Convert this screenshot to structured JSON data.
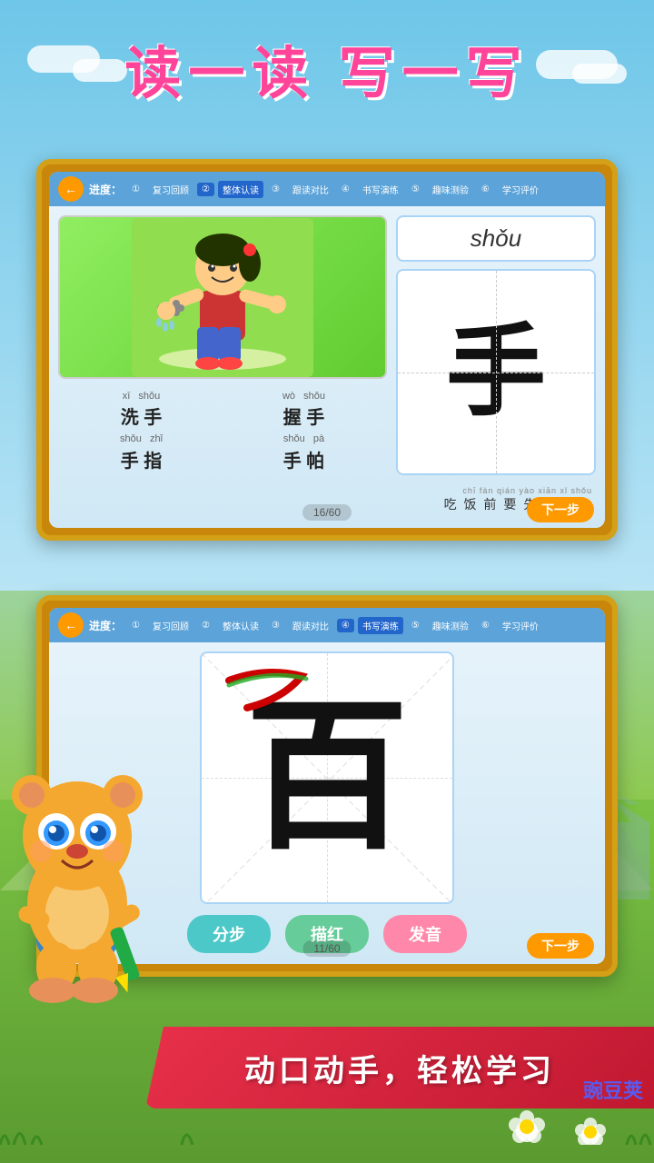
{
  "app": {
    "title": "读一读 写一写",
    "brand": "豌豆荚"
  },
  "card1": {
    "back_label": "←",
    "progress_label": "进度：",
    "steps": [
      {
        "num": "①",
        "label": "复习回顾",
        "active": false
      },
      {
        "num": "②",
        "label": "整体认读",
        "active": true
      },
      {
        "num": "③",
        "label": "跟读对比",
        "active": false
      },
      {
        "num": "④",
        "label": "书写演练",
        "active": false
      },
      {
        "num": "⑤",
        "label": "趣味测验",
        "active": false
      },
      {
        "num": "⑥",
        "label": "学习评价",
        "active": false
      }
    ],
    "pinyin": "shǒu",
    "character": "手",
    "words": [
      {
        "pinyin1": "xī",
        "pinyin2": "shǒu",
        "text": "洗 手"
      },
      {
        "pinyin1": "wò",
        "pinyin2": "shǒu",
        "text": "握 手"
      },
      {
        "pinyin1": "shǒu",
        "pinyin2": "zhǐ",
        "text": "手 指"
      },
      {
        "pinyin1": "shǒu",
        "pinyin2": "pà",
        "text": "手 帕"
      }
    ],
    "sentence_pinyin": "chī  fàn  qián  yào  xiān  xǐ  shǒu",
    "sentence_text": "吃 饭 前 要 先 洗 手。",
    "page_counter": "16/60",
    "next_label": "下一步"
  },
  "card2": {
    "back_label": "←",
    "progress_label": "进度：",
    "steps": [
      {
        "num": "①",
        "label": "复习回顾",
        "active": false
      },
      {
        "num": "②",
        "label": "整体认读",
        "active": false
      },
      {
        "num": "③",
        "label": "跟读对比",
        "active": false
      },
      {
        "num": "④",
        "label": "书写演练",
        "active": true
      },
      {
        "num": "⑤",
        "label": "趣味测验",
        "active": false
      },
      {
        "num": "⑥",
        "label": "学习评价",
        "active": false
      }
    ],
    "character": "百",
    "btn_steps": "分步",
    "btn_trace": "描红",
    "btn_sound": "发音",
    "page_counter": "11/60",
    "next_label": "下一步"
  },
  "banner": {
    "text": "动口动手，轻松学习"
  },
  "colors": {
    "progress_active": "#2255CC",
    "orange": "#FF9900",
    "teal": "#4CC8C8",
    "green_btn": "#66CC99",
    "pink_btn": "#FF88AA"
  }
}
